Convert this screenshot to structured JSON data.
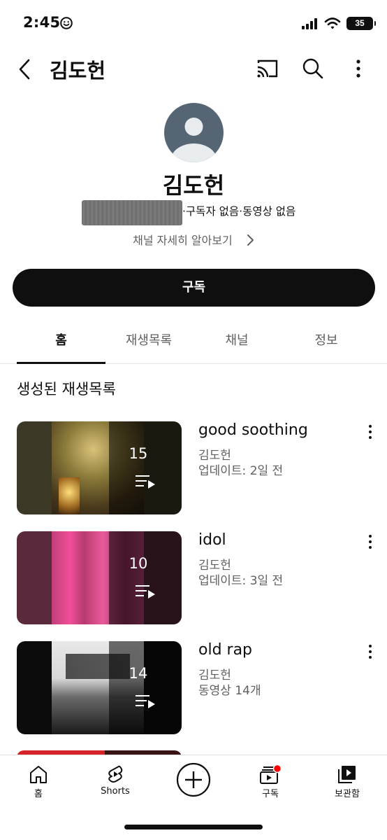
{
  "status_bar": {
    "time": "2:45",
    "battery": "35"
  },
  "header": {
    "title": "김도헌"
  },
  "channel": {
    "name": "김도헌",
    "meta": "·구독자 없음·동영상 없음",
    "about_link": "채널 자세히 알아보기",
    "subscribe_label": "구독"
  },
  "tabs": [
    {
      "label": "홈",
      "active": true
    },
    {
      "label": "재생목록",
      "active": false
    },
    {
      "label": "채널",
      "active": false
    },
    {
      "label": "정보",
      "active": false
    }
  ],
  "section": {
    "title": "생성된 재생목록"
  },
  "playlists": [
    {
      "title": "good soothing",
      "owner": "김도헌",
      "info": "업데이트: 2일 전",
      "count": "15"
    },
    {
      "title": "idol",
      "owner": "김도헌",
      "info": "업데이트: 3일 전",
      "count": "10"
    },
    {
      "title": "old rap",
      "owner": "김도헌",
      "info": "동영상 14개",
      "count": "14"
    }
  ],
  "bottom_nav": {
    "home": "홈",
    "shorts": "Shorts",
    "subscriptions": "구독",
    "library": "보관함"
  },
  "colors": {
    "accent": "#0f0f0f",
    "notification": "#ff0000",
    "secondary_text": "#606060"
  }
}
